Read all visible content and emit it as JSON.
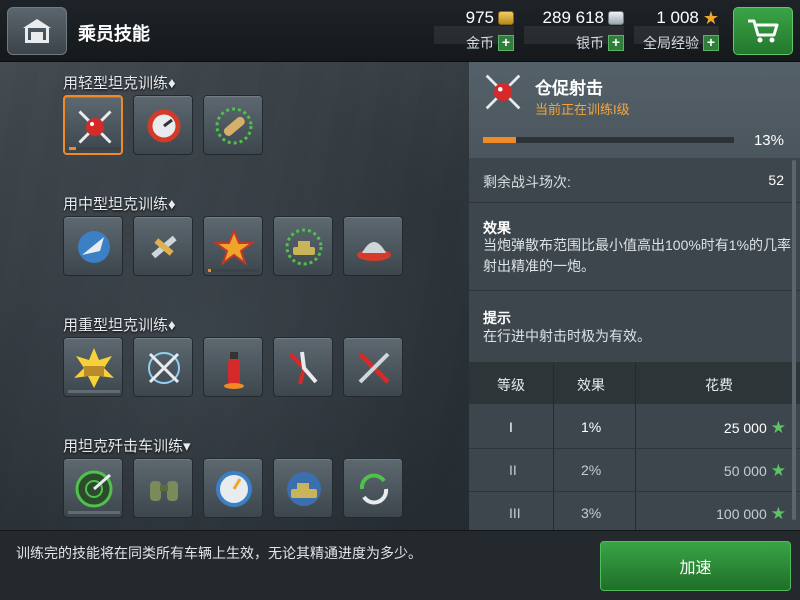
{
  "header": {
    "title": "乘员技能",
    "currencies": [
      {
        "value": "975",
        "label": "金币",
        "icon": "gold-coin-icon"
      },
      {
        "value": "289 618",
        "label": "银币",
        "icon": "silver-coin-icon"
      },
      {
        "value": "1 008",
        "label": "全局经验",
        "icon": "star-icon"
      }
    ],
    "plus": "+",
    "star": "★"
  },
  "groups": [
    {
      "title": "用轻型坦克训练♦",
      "skills": [
        "snap-shot-icon",
        "repair-gauge-icon",
        "ammo-shell-icon"
      ]
    },
    {
      "title": "用中型坦克训练♦",
      "skills": [
        "rocket-boost-icon",
        "crossed-wrench-icon",
        "star-shield-icon",
        "tank-target-icon",
        "helmet-icon"
      ]
    },
    {
      "title": "用重型坦克训练♦",
      "skills": [
        "armor-explosion-icon",
        "crossed-swords-icon",
        "fire-extinguisher-icon",
        "pliers-icon",
        "tools-icon"
      ]
    },
    {
      "title": "用坦克歼击车训练▾",
      "skills": [
        "sniper-target-icon",
        "binoculars-icon",
        "speedometer-icon",
        "camo-tank-icon",
        "reload-icon"
      ]
    }
  ],
  "detail": {
    "name": "仓促射击",
    "status": "当前正在训练I级",
    "progress_percent": 13,
    "progress_text": "13%",
    "remain_label": "剩余战斗场次:",
    "remain_value": "52",
    "effect_title": "效果",
    "effect_text": "当炮弹散布范围比最小值高出100%时有1%的几率射出精准的一炮。",
    "tip_title": "提示",
    "tip_text": "在行进中射击时极为有效。",
    "table": {
      "headers": [
        "等级",
        "效果",
        "花费"
      ],
      "rows": [
        {
          "level": "I",
          "effect": "1%",
          "cost": "25 000"
        },
        {
          "level": "II",
          "effect": "2%",
          "cost": "50 000"
        },
        {
          "level": "III",
          "effect": "3%",
          "cost": "100 000"
        }
      ],
      "cost_icon": "★"
    }
  },
  "footer": {
    "note": "训练完的技能将在同类所有车辆上生效，无论其精通进度为多少。",
    "button": "加速"
  }
}
